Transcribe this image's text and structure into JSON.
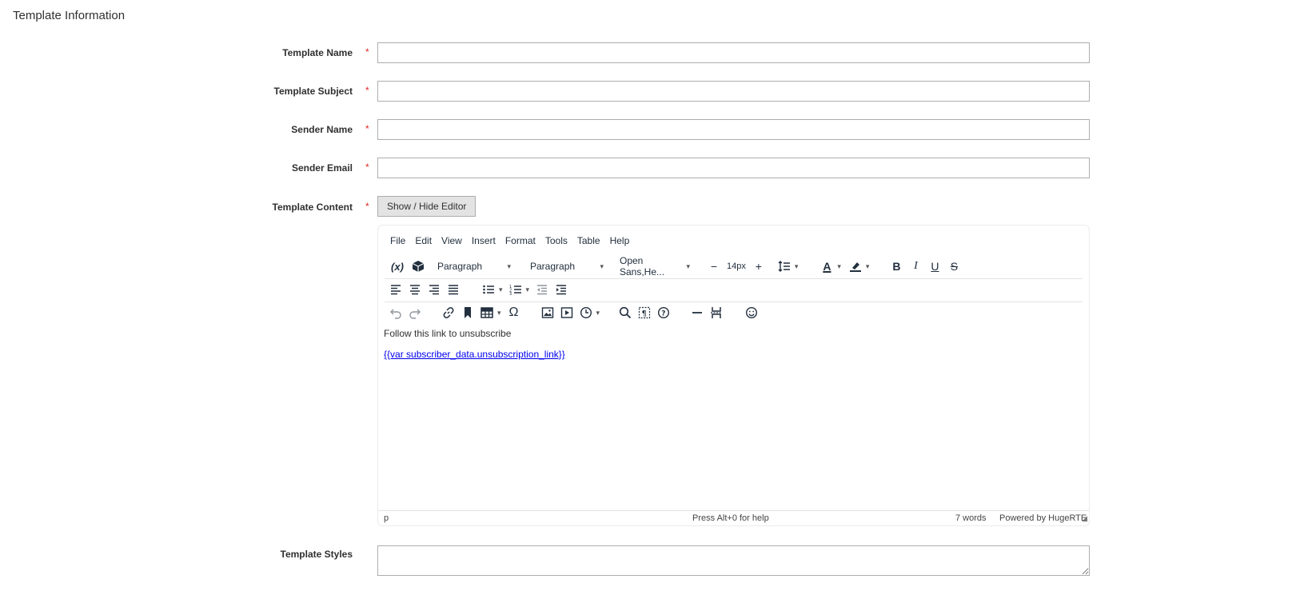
{
  "section_title": "Template Information",
  "fields": {
    "name": {
      "label": "Template Name",
      "value": "",
      "required_mark": "*"
    },
    "subject": {
      "label": "Template Subject",
      "value": "",
      "required_mark": "*"
    },
    "sender_name": {
      "label": "Sender Name",
      "value": "",
      "required_mark": "*"
    },
    "sender_email": {
      "label": "Sender Email",
      "value": "",
      "required_mark": "*"
    },
    "content": {
      "label": "Template Content",
      "required_mark": "*"
    },
    "styles": {
      "label": "Template Styles",
      "value": ""
    }
  },
  "toggle_editor_label": "Show / Hide Editor",
  "editor": {
    "menu": [
      "File",
      "Edit",
      "View",
      "Insert",
      "Format",
      "Tools",
      "Table",
      "Help"
    ],
    "variable_icon_text": "(x)",
    "block_format_1": "Paragraph",
    "block_format_2": "Paragraph",
    "font_family": "Open Sans,He...",
    "font_size": "14px",
    "body_text": "Follow this link to unsubscribe",
    "link_text": "{{var subscriber_data.unsubscription_link}}",
    "status_path": "p",
    "status_help": "Press Alt+0 for help",
    "status_words": "7 words",
    "status_powered": "Powered by HugeRTE"
  },
  "colors": {
    "required": "#e22626",
    "link": "#0000ee",
    "border": "#adadad"
  }
}
